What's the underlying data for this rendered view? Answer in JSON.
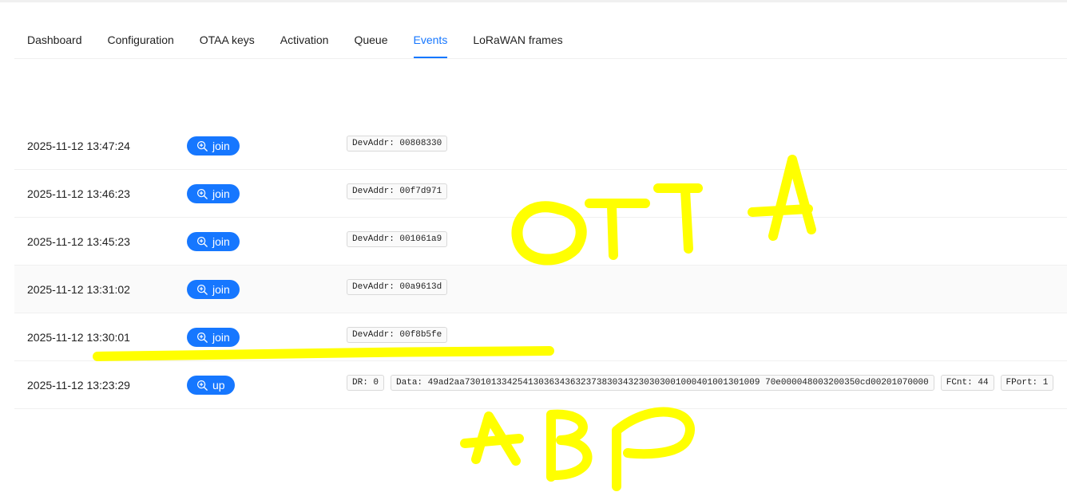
{
  "tabs": [
    {
      "label": "Dashboard"
    },
    {
      "label": "Configuration"
    },
    {
      "label": "OTAA keys"
    },
    {
      "label": "Activation"
    },
    {
      "label": "Queue"
    },
    {
      "label": "Events",
      "active": true
    },
    {
      "label": "LoRaWAN frames"
    }
  ],
  "colors": {
    "accent": "#1677ff",
    "annotation": "#ffff00"
  },
  "events": [
    {
      "time": "2025-11-12 13:47:24",
      "type": "join",
      "icon": "zoom-in-icon",
      "fields": [
        "DevAddr: 00808330"
      ]
    },
    {
      "time": "2025-11-12 13:46:23",
      "type": "join",
      "icon": "zoom-in-icon",
      "fields": [
        "DevAddr: 00f7d971"
      ]
    },
    {
      "time": "2025-11-12 13:45:23",
      "type": "join",
      "icon": "zoom-in-icon",
      "fields": [
        "DevAddr: 001061a9"
      ]
    },
    {
      "time": "2025-11-12 13:31:02",
      "type": "join",
      "icon": "zoom-in-icon",
      "fields": [
        "DevAddr: 00a9613d"
      ]
    },
    {
      "time": "2025-11-12 13:30:01",
      "type": "join",
      "icon": "zoom-in-icon",
      "fields": [
        "DevAddr: 00f8b5fe"
      ]
    },
    {
      "time": "2025-11-12 13:23:29",
      "type": "up",
      "icon": "zoom-in-icon",
      "fields": [
        "DR: 0",
        "Data: 49ad2aa73010133425413036343632373830343230303001000401001301009 70e000048003200350cd00201070000",
        "FCnt: 44",
        "FPort: 1"
      ]
    }
  ],
  "annotations": {
    "otaa_label": "OTTA",
    "abp_label": "ABP"
  }
}
